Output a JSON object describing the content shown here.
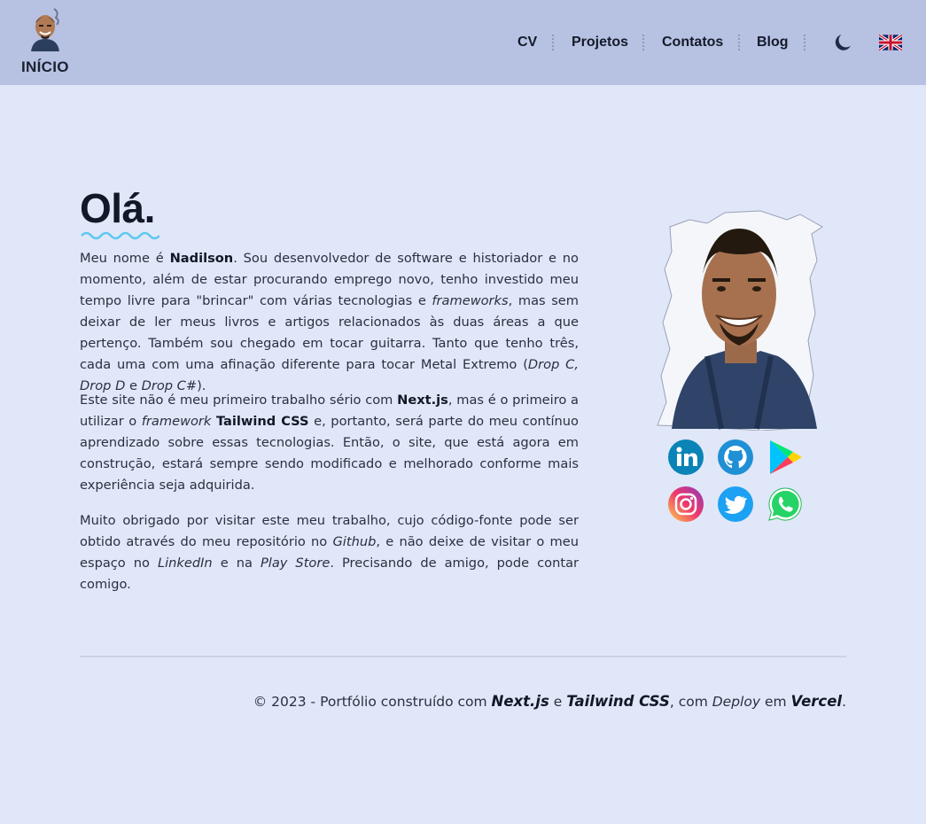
{
  "header": {
    "home_label": "INÍCIO",
    "nav": [
      {
        "label": "CV"
      },
      {
        "label": "Projetos"
      },
      {
        "label": "Contatos"
      },
      {
        "label": "Blog"
      }
    ],
    "theme_icon": "moon-icon",
    "language_icon": "uk-flag-icon"
  },
  "main": {
    "greeting": "Olá.",
    "p1": {
      "a": "Meu nome é ",
      "name": "Nadilson",
      "b": ". Sou desenvolvedor de software e historiador e no momento, além de estar procurando emprego novo, tenho investido meu tempo livre para \"brincar\" com várias tecnologias e ",
      "frameworks": "frameworks",
      "c": ", mas sem deixar de ler meus livros e artigos relacionados às duas áreas a que pertenço. Também sou chegado em tocar guitarra. Tanto que tenho três, cada uma com uma afinação diferente para tocar Metal Extremo (",
      "drop_c": "Drop C",
      "comma": ", ",
      "drop_d": "Drop D",
      "e": " e ",
      "drop_csharp": "Drop C#",
      "end": ")."
    },
    "p2": {
      "a": "Este site não é meu primeiro trabalho sério com ",
      "nextjs": "Next.js",
      "b": ", mas é o primeiro a utilizar o ",
      "framework": "framework",
      "space": " ",
      "tailwind": "Tailwind CSS",
      "c": " e, portanto, será parte do meu contínuo aprendizado sobre essas tecnologias. Então, o site, que está agora em construção, estará sempre sendo modificado e melhorado conforme mais experiência seja adquirida."
    },
    "p3": {
      "a": "Muito obrigado por visitar este meu trabalho, cujo código-fonte pode ser obtido através do meu repositório no ",
      "github": "Github",
      "b": ", e não deixe de visitar o meu espaço no ",
      "linkedin": "LinkedIn",
      "c": " e na ",
      "playstore": "Play Store",
      "d": ". Precisando de amigo, pode contar comigo."
    },
    "social": [
      "linkedin-icon",
      "github-icon",
      "google-play-icon",
      "instagram-icon",
      "twitter-icon",
      "whatsapp-icon"
    ]
  },
  "footer": {
    "a": "© 2023 - Portfólio construído com ",
    "nextjs": "Next.js",
    "b": " e ",
    "tailwind": "Tailwind CSS",
    "c": ", com ",
    "deploy": "Deploy",
    "d": " em ",
    "vercel": "Vercel",
    "end": "."
  },
  "colors": {
    "header_bg": "#b7c1e2",
    "page_bg": "#e0e7f8",
    "wave": "#5ec8f0"
  }
}
